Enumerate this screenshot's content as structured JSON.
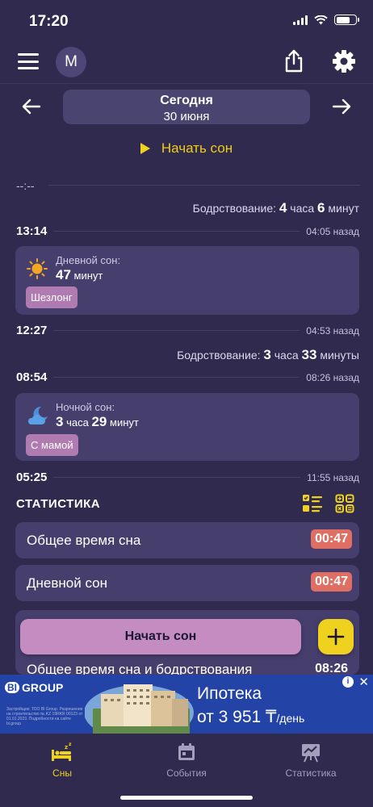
{
  "status": {
    "time": "17:20"
  },
  "header": {
    "avatar_letter": "M"
  },
  "date_nav": {
    "title": "Сегодня",
    "subtitle": "30 июня"
  },
  "start_sleep_label": "Начать сон",
  "timeline": {
    "placeholder_time": "--:--",
    "awake_1": {
      "label": "Бодрствование:",
      "h": "4",
      "h_unit": "часа",
      "m": "6",
      "m_unit": "минут"
    },
    "row_1": {
      "time": "13:14",
      "ago": "04:05 назад"
    },
    "card_1": {
      "label": "Дневной сон:",
      "value": "47",
      "unit": "минут",
      "tag": "Шезлонг",
      "icon": "sun-icon"
    },
    "row_2": {
      "time": "12:27",
      "ago": "04:53 назад"
    },
    "awake_2": {
      "label": "Бодрствование:",
      "h": "3",
      "h_unit": "часа",
      "m": "33",
      "m_unit": "минуты"
    },
    "row_3": {
      "time": "08:54",
      "ago": "08:26 назад"
    },
    "card_2": {
      "label": "Ночной сон:",
      "h": "3",
      "h_unit": "часа",
      "m": "29",
      "m_unit": "минут",
      "tag": "С мамой",
      "icon": "moon-cloud-icon"
    },
    "row_4": {
      "time": "05:25",
      "ago": "11:55 назад"
    }
  },
  "stats": {
    "title": "СТАТИСТИКА",
    "rows": [
      {
        "label": "Общее время сна",
        "value": "00:47"
      },
      {
        "label": "Дневной сон",
        "value": "00:47"
      },
      {
        "label": "Общее время сна и бодрствования",
        "value": "08:26"
      }
    ]
  },
  "fab": {
    "main_label": "Начать сон"
  },
  "ad": {
    "brand": "GROUP",
    "brand_badge": "BI",
    "line1": "Ипотека",
    "line2": "от 3 951 ₸",
    "line2_suffix": "/день",
    "fine_print": "Застройщик: ТОО BI Group. Разрешение на строительство № KZ 19RKR 00123 от 01.01.2023. Подробности на сайте bi.group",
    "close": "✕"
  },
  "tabs": [
    {
      "label": "Сны",
      "active": true
    },
    {
      "label": "События",
      "active": false
    },
    {
      "label": "Статистика",
      "active": false
    }
  ],
  "colors": {
    "background": "#2f2a4e",
    "card": "#463f6e",
    "accent": "#efd21f",
    "badge": "#e06f63",
    "tag": "#b07bb0"
  }
}
